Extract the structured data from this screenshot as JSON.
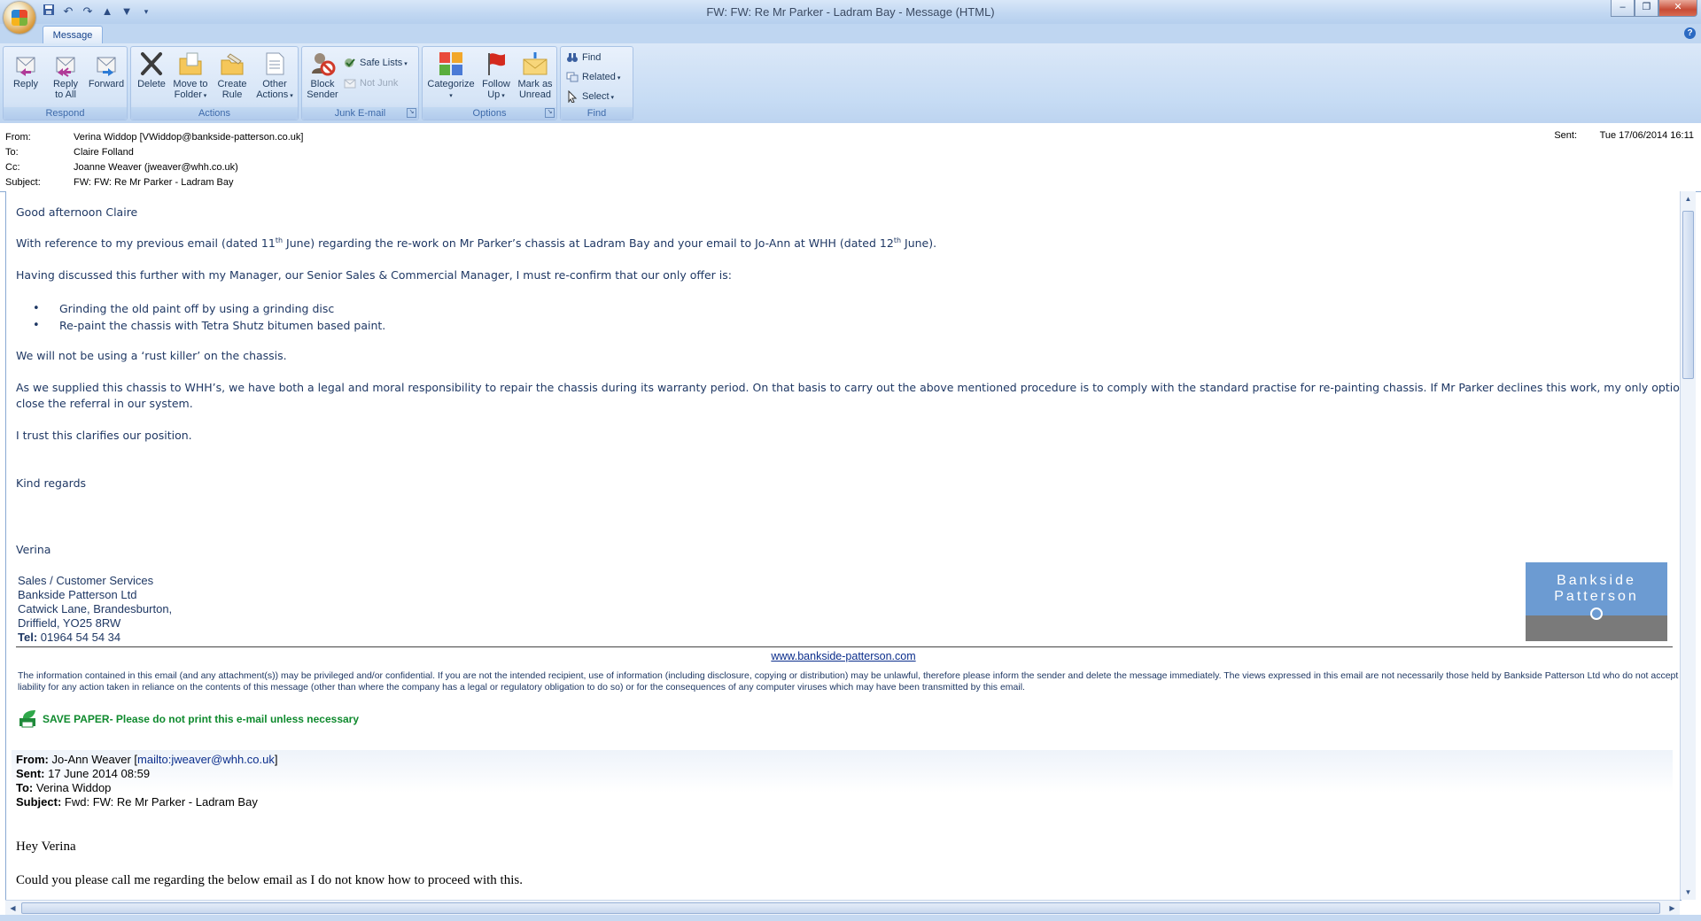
{
  "window": {
    "title": "FW: FW: Re Mr Parker - Ladram Bay - Message (HTML)",
    "qat": [
      "save-icon",
      "undo-icon",
      "redo-icon",
      "up-arrow-icon",
      "down-arrow-icon",
      "customize-icon"
    ],
    "minimize": "–",
    "restore": "❐",
    "close": "✕"
  },
  "ribbon": {
    "tab": "Message",
    "help": "?",
    "groups": {
      "respond": {
        "label": "Respond",
        "reply": "Reply",
        "reply_all_1": "Reply",
        "reply_all_2": "to All",
        "forward": "Forward"
      },
      "actions": {
        "label": "Actions",
        "delete": "Delete",
        "move_1": "Move to",
        "move_2": "Folder",
        "create_1": "Create",
        "create_2": "Rule",
        "other_1": "Other",
        "other_2": "Actions"
      },
      "junk": {
        "label": "Junk E-mail",
        "block_1": "Block",
        "block_2": "Sender",
        "safe_lists": "Safe Lists",
        "not_junk": "Not Junk"
      },
      "options": {
        "label": "Options",
        "categorize": "Categorize",
        "follow_1": "Follow",
        "follow_2": "Up",
        "mark_1": "Mark as",
        "mark_2": "Unread"
      },
      "find": {
        "label": "Find",
        "find": "Find",
        "related": "Related",
        "select": "Select"
      }
    }
  },
  "header": {
    "from_label": "From:",
    "from": "Verina Widdop [VWiddop@bankside-patterson.co.uk]",
    "to_label": "To:",
    "to": "Claire Folland",
    "cc_label": "Cc:",
    "cc": "Joanne Weaver (jweaver@whh.co.uk)",
    "subject_label": "Subject:",
    "subject": "FW: FW: Re Mr Parker - Ladram Bay",
    "sent_label": "Sent:",
    "sent": "Tue 17/06/2014 16:11"
  },
  "body": {
    "greeting": "Good afternoon Claire",
    "p1_a": "With reference to my previous email (dated 11",
    "p1_sup1": "th",
    "p1_b": " June) regarding the re-work on Mr Parker’s chassis at Ladram Bay and your email to Jo-Ann at WHH (dated 12",
    "p1_sup2": "th",
    "p1_c": " June).",
    "p2": "Having discussed this further with my Manager, our Senior Sales & Commercial  Manager,  I must re-confirm that our only offer is:",
    "bullets": [
      "Grinding the old paint off by using a grinding disc",
      "Re-paint the chassis with Tetra Shutz bitumen based paint."
    ],
    "p3": "We will not be using a ‘rust killer’ on the chassis.",
    "p4_line1": "As we supplied this chassis to WHH’s, we have both a legal and moral responsibility to repair the chassis during its warranty period.  On that basis to carry out the above mentioned procedure is to comply with the standard practise for re-painting chassis.  If Mr Parker declines this work, my only option is to",
    "p4_line2": "close the referral in our system.",
    "p5": "I trust this clarifies our position.",
    "closing": "Kind regards",
    "name": "Verina",
    "signature": [
      "Sales / Customer Services",
      "Bankside Patterson Ltd",
      "Catwick Lane, Brandesburton,",
      "Driffield, YO25 8RW"
    ],
    "tel_label": "Tel:",
    "tel": " 01964 54 54 34",
    "logo_line1": "Bankside",
    "logo_line2": "Patterson",
    "website": "www.bankside-patterson.com",
    "disclaimer": "The information contained in this email (and any attachment(s)) may be privileged and/or confidential. If you are not the intended recipient, use of information (including disclosure, copying or distribution) may be unlawful, therefore please inform the sender and delete the message immediately. The views expressed in this email are not necessarily those held by Bankside Patterson Ltd who do not accept liability for any action taken in reliance on the contents of this message (other than where the company has a legal or regulatory obligation to do so) or for the consequences of any computer viruses which may have been transmitted by this email.",
    "save_paper": "SAVE PAPER",
    "save_paper_rest": " - Please do not print this e-mail unless necessary",
    "fwd": {
      "from_label": "From:",
      "from_name": " Jo-Ann Weaver [",
      "from_link": "mailto:jweaver@whh.co.uk",
      "from_end": "]",
      "sent_label": "Sent:",
      "sent": " 17 June 2014 08:59",
      "to_label": "To:",
      "to": " Verina Widdop",
      "subject_label": "Subject:",
      "subject": " Fwd: FW: Re Mr Parker - Ladram Bay"
    },
    "fwd_greeting": "Hey Verina",
    "fwd_p1": "Could you please call me regarding the below email as I do not know how to proceed with this."
  },
  "colors": {
    "ribbon_text": "#1e395b",
    "body_text": "#1f3864",
    "link": "#0b2e8c",
    "save_paper": "#0f8a2e",
    "logo_blue": "#6c9bd2",
    "logo_grey": "#7a7a7a"
  }
}
